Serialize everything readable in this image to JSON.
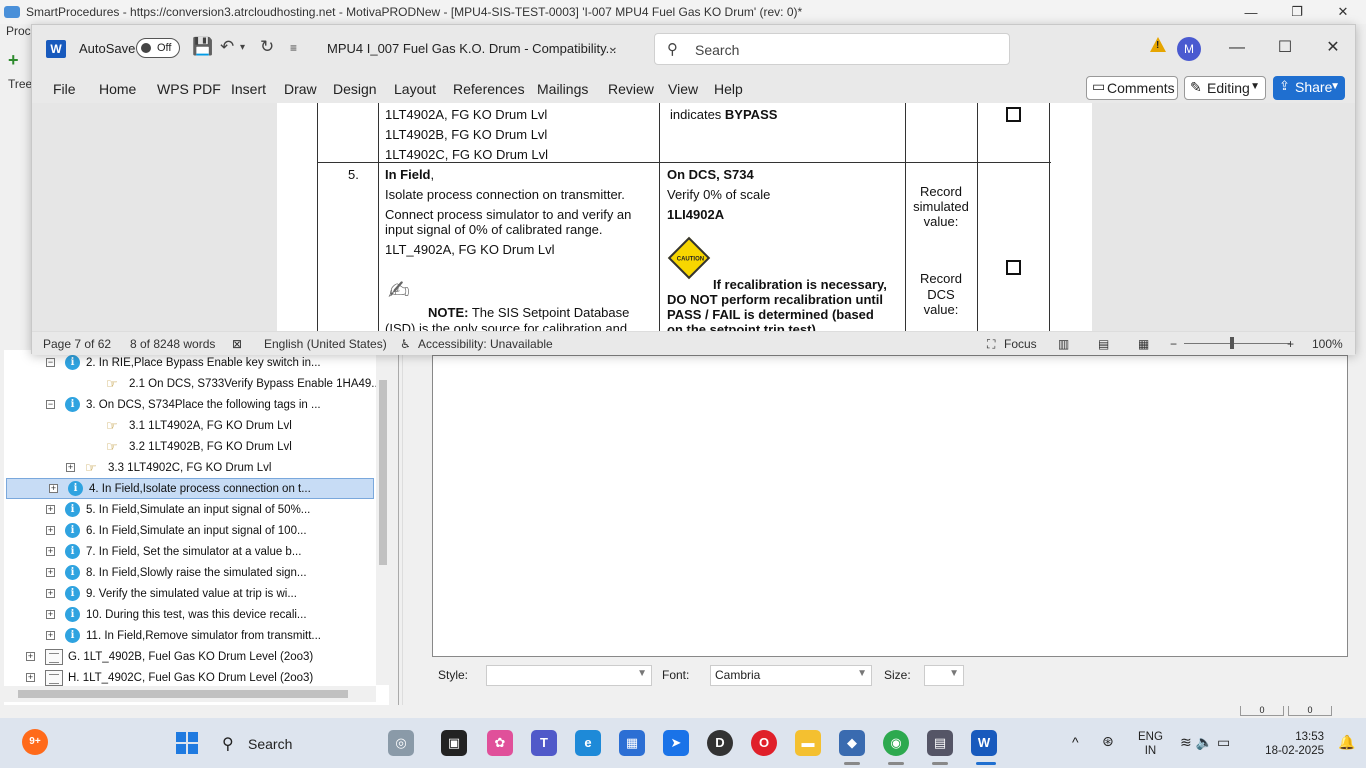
{
  "background_app": {
    "title": "SmartProcedures - https://conversion3.atrcloudhosting.net - MotivaPRODNew - [MPU4-SIS-TEST-0003] 'I-007 MPU4 Fuel Gas KO Drum' (rev: 0)*",
    "menu_partial": "Proc",
    "tree_label_partial": "Tree",
    "window_controls": [
      "—",
      "❐",
      "✕"
    ]
  },
  "tree": {
    "rows": [
      {
        "exp": "⊟",
        "icon": "info",
        "text": "2. In RIE,Place Bypass Enable key switch in..."
      },
      {
        "exp": "",
        "icon": "hand",
        "text": "2.1 On DCS, S733Verify Bypass Enable 1HA49..."
      },
      {
        "exp": "⊟",
        "icon": "info",
        "text": "3. On DCS, S734Place the following tags in ..."
      },
      {
        "exp": "",
        "icon": "hand",
        "text": "3.1 1LT4902A, FG KO Drum Lvl"
      },
      {
        "exp": "",
        "icon": "hand",
        "text": "3.2 1LT4902B, FG KO Drum Lvl"
      },
      {
        "exp": "⊞",
        "icon": "hand",
        "text": "3.3 1LT4902C, FG KO Drum Lvl"
      },
      {
        "exp": "⊞",
        "icon": "info",
        "text": "4. In Field,Isolate process connection on t...",
        "selected": true
      },
      {
        "exp": "⊞",
        "icon": "info",
        "text": "5. In Field,Simulate an input signal of 50%..."
      },
      {
        "exp": "⊞",
        "icon": "info",
        "text": "6. In Field,Simulate an input signal of 100..."
      },
      {
        "exp": "⊞",
        "icon": "info",
        "text": "7. In Field, Set the simulator at a value b..."
      },
      {
        "exp": "⊞",
        "icon": "info",
        "text": "8. In Field,Slowly raise the simulated sign..."
      },
      {
        "exp": "⊞",
        "icon": "info",
        "text": "9. Verify the simulated value at trip is wi..."
      },
      {
        "exp": "⊞",
        "icon": "info",
        "text": "10. During this test, was this device recali..."
      },
      {
        "exp": "⊞",
        "icon": "info",
        "text": "11. In Field,Remove simulator from transmitt..."
      },
      {
        "exp": "⊞",
        "icon": "doc",
        "text": "G. 1LT_4902B, Fuel Gas KO Drum Level (2oo3)"
      },
      {
        "exp": "⊞",
        "icon": "doc",
        "text": "H. 1LT_4902C, Fuel Gas KO Drum Level (2oo3)"
      }
    ]
  },
  "style_bar": {
    "style_label": "Style:",
    "style_value": "",
    "font_label": "Font:",
    "font_value": "Cambria",
    "size_label": "Size:",
    "size_value": ""
  },
  "bg_status": [
    "0",
    "0"
  ],
  "word": {
    "logo": "W",
    "autosave_label": "AutoSave",
    "autosave_state": "Off",
    "doc_title": "MPU4 I_007 Fuel Gas K.O. Drum  -  Compatibility...",
    "search_placeholder": "Search",
    "avatar_initial": "M",
    "tabs": [
      "File",
      "Home",
      "WPS PDF",
      "Insert",
      "Draw",
      "Design",
      "Layout",
      "References",
      "Mailings",
      "Review",
      "View",
      "Help"
    ],
    "comments_label": "Comments",
    "editing_label": "Editing",
    "share_label": "Share",
    "status": {
      "page": "Page 7 of 62",
      "words": "8 of 8248 words",
      "language": "English (United States)",
      "accessibility": "Accessibility: Unavailable",
      "focus": "Focus",
      "zoom": "100%"
    }
  },
  "doc": {
    "prev_row": {
      "tags": [
        "1LT4902A, FG KO Drum Lvl",
        "1LT4902B, FG KO Drum Lvl",
        "1LT4902C, FG KO Drum Lvl"
      ],
      "dcs_prefix": "indicates ",
      "dcs_bold": "BYPASS"
    },
    "row5": {
      "step": "5.",
      "field_bold": "In Field",
      "field_comma": ",",
      "isolate": "Isolate process connection on transmitter.",
      "connect1": "Connect process simulator to and verify an",
      "connect2": "input signal of 0% of calibrated range.",
      "tag": "1LT_4902A, FG KO Drum Lvl",
      "note_bold": "NOTE:",
      "note1": " The SIS Setpoint Database",
      "note2": "(ISD) is the only source for calibration and",
      "dcs_heading": "On DCS, S734",
      "verify": "Verify 0% of scale",
      "indicator": "1LI4902A",
      "caution_label": "CAUTION",
      "caution1": "If recalibration is necessary,",
      "caution2": "DO NOT perform recalibration until",
      "caution3": "PASS / FAIL is determined (based",
      "caution4": "on the setpoint trip test)",
      "record1": [
        "Record",
        "simulated",
        "value:"
      ],
      "record2": [
        "Record",
        "DCS",
        "value:"
      ]
    }
  },
  "taskbar": {
    "notif_count": "9+",
    "search_label": "Search",
    "lang_line1": "ENG",
    "lang_line2": "IN",
    "time": "13:53",
    "date": "18-02-2025"
  }
}
